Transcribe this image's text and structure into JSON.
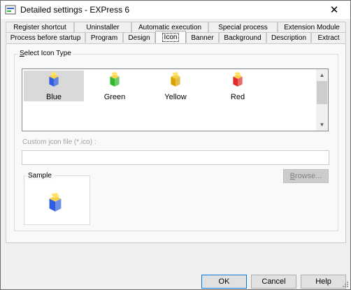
{
  "window": {
    "title": "Detailed settings - EXPress 6",
    "close_glyph": "✕"
  },
  "tabs_row1": [
    {
      "label": "Register shortcut"
    },
    {
      "label": "Uninstaller"
    },
    {
      "label": "Automatic execution"
    },
    {
      "label": "Special process"
    },
    {
      "label": "Extension Module"
    }
  ],
  "tabs_row2": [
    {
      "label": "Process before startup"
    },
    {
      "label": "Program"
    },
    {
      "label": "Design"
    },
    {
      "label": "Icon",
      "active": true
    },
    {
      "label": "Banner"
    },
    {
      "label": "Background"
    },
    {
      "label": "Description"
    },
    {
      "label": "Extract"
    }
  ],
  "select_group": {
    "label_prefix": "",
    "label_accel": "S",
    "label_rest": "elect Icon Type"
  },
  "icon_types": [
    {
      "label": "Blue",
      "color": "#2f5fe0",
      "selected": true
    },
    {
      "label": "Green",
      "color": "#2fb82f"
    },
    {
      "label": "Yellow",
      "color": "#d9a400"
    },
    {
      "label": "Red",
      "color": "#e02a2a"
    }
  ],
  "custom_file": {
    "label_prefix": "Custom ",
    "label_accel": "i",
    "label_rest": "con file (*.ico) :",
    "value": ""
  },
  "browse": {
    "label_accel": "B",
    "label_rest": "rowse..."
  },
  "sample": {
    "label": "Sample",
    "icon_color": "#2f5fe0"
  },
  "buttons": {
    "ok": "OK",
    "cancel": "Cancel",
    "help": "Help"
  },
  "scroll": {
    "up_glyph": "▲",
    "down_glyph": "▼"
  }
}
